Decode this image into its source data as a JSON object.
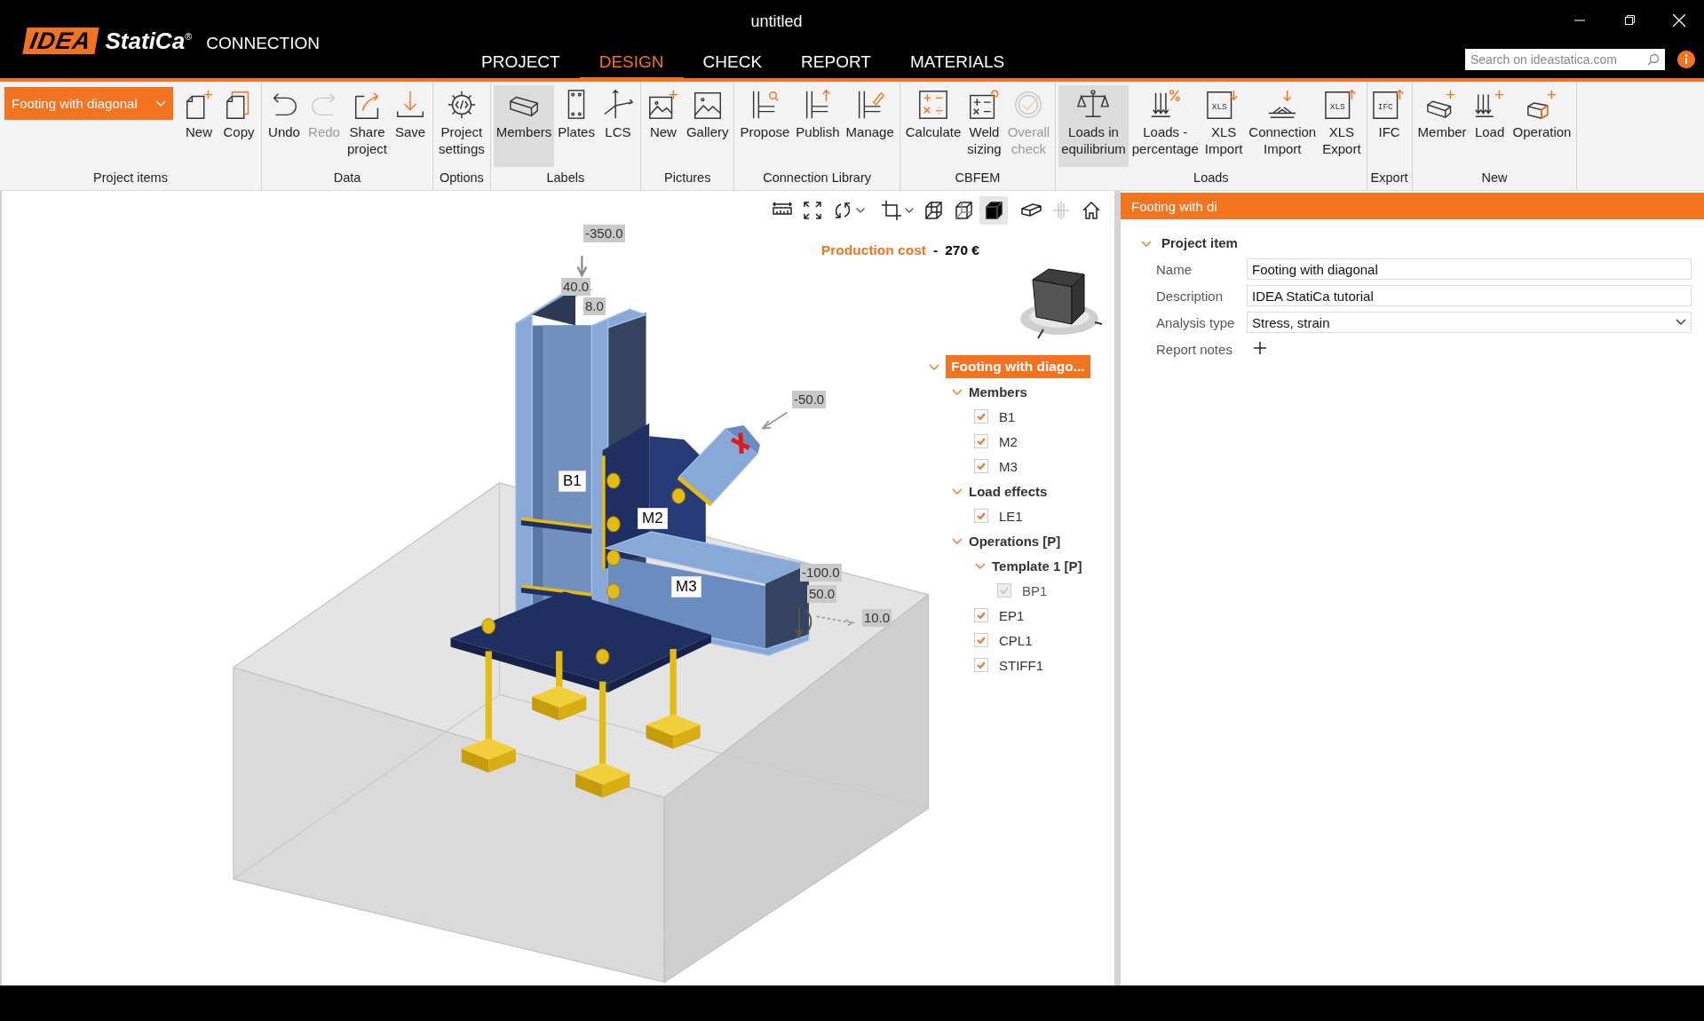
{
  "window": {
    "title": "untitled"
  },
  "logo": {
    "mark": "IDEA",
    "name": "StatiCa$^{®}$",
    "product": "CONNECTION"
  },
  "menu_tabs": [
    {
      "label": "PROJECT",
      "selected": false
    },
    {
      "label": "DESIGN",
      "selected": true
    },
    {
      "label": "CHECK",
      "selected": false
    },
    {
      "label": "REPORT",
      "selected": false
    },
    {
      "label": "MATERIALS",
      "selected": false
    }
  ],
  "search": {
    "placeholder": "Search on ideastatica.com"
  },
  "ribbon": {
    "project_item": "Footing with diagonal",
    "groups": [
      {
        "label": "Project items",
        "buttons": [
          {
            "lines": [
              "New"
            ],
            "selected": false,
            "disabled": false
          },
          {
            "lines": [
              "Copy"
            ],
            "selected": false,
            "disabled": false
          }
        ]
      },
      {
        "label": "Data",
        "buttons": [
          {
            "lines": [
              "Undo"
            ],
            "selected": false,
            "disabled": false
          },
          {
            "lines": [
              "Redo"
            ],
            "selected": false,
            "disabled": true
          },
          {
            "lines": [
              "Share",
              "project"
            ],
            "selected": false,
            "disabled": false
          },
          {
            "lines": [
              "Save"
            ],
            "selected": false,
            "disabled": false
          }
        ]
      },
      {
        "label": "Options",
        "buttons": [
          {
            "lines": [
              "Project",
              "settings"
            ],
            "selected": false,
            "disabled": false
          }
        ]
      },
      {
        "label": "Labels",
        "buttons": [
          {
            "lines": [
              "Members"
            ],
            "selected": true,
            "disabled": false
          },
          {
            "lines": [
              "Plates"
            ],
            "selected": false,
            "disabled": false
          },
          {
            "lines": [
              "LCS"
            ],
            "selected": false,
            "disabled": false
          }
        ]
      },
      {
        "label": "Pictures",
        "buttons": [
          {
            "lines": [
              "New"
            ],
            "selected": false,
            "disabled": false
          },
          {
            "lines": [
              "Gallery"
            ],
            "selected": false,
            "disabled": false
          }
        ]
      },
      {
        "label": "Connection Library",
        "buttons": [
          {
            "lines": [
              "Propose"
            ],
            "selected": false,
            "disabled": false
          },
          {
            "lines": [
              "Publish"
            ],
            "selected": false,
            "disabled": false
          },
          {
            "lines": [
              "Manage"
            ],
            "selected": false,
            "disabled": false
          }
        ]
      },
      {
        "label": "CBFEM",
        "buttons": [
          {
            "lines": [
              "Calculate"
            ],
            "selected": false,
            "disabled": false
          },
          {
            "lines": [
              "Weld",
              "sizing"
            ],
            "selected": false,
            "disabled": false
          },
          {
            "lines": [
              "Overall",
              "check"
            ],
            "selected": false,
            "disabled": true
          }
        ]
      },
      {
        "label": "Loads",
        "buttons": [
          {
            "lines": [
              "Loads in",
              "equilibrium"
            ],
            "selected": true,
            "disabled": false
          },
          {
            "lines": [
              "Loads -",
              "percentage"
            ],
            "selected": false,
            "disabled": false
          },
          {
            "lines": [
              "XLS",
              "Import"
            ],
            "icon_text": "XLS",
            "selected": false,
            "disabled": false
          },
          {
            "lines": [
              "Connection",
              "Import"
            ],
            "selected": false,
            "disabled": false
          },
          {
            "lines": [
              "XLS",
              "Export"
            ],
            "icon_text": "XLS",
            "selected": false,
            "disabled": false
          }
        ]
      },
      {
        "label": "Export",
        "buttons": [
          {
            "lines": [
              "IFC"
            ],
            "icon_text": "IFC",
            "selected": false,
            "disabled": false
          }
        ]
      },
      {
        "label": "New",
        "buttons": [
          {
            "lines": [
              "Member"
            ],
            "selected": false,
            "disabled": false
          },
          {
            "lines": [
              "Load"
            ],
            "selected": false,
            "disabled": false
          },
          {
            "lines": [
              "Operation"
            ],
            "selected": false,
            "disabled": false
          }
        ]
      }
    ]
  },
  "view_toolbar": [
    {
      "selected": false,
      "disabled": false,
      "dropdown": false
    },
    {
      "selected": false,
      "disabled": false,
      "dropdown": false
    },
    {
      "selected": false,
      "disabled": false,
      "dropdown": true
    },
    {
      "selected": false,
      "disabled": false,
      "dropdown": true
    },
    {
      "selected": false,
      "disabled": false,
      "dropdown": false
    },
    {
      "selected": false,
      "disabled": false,
      "dropdown": false
    },
    {
      "selected": true,
      "disabled": false,
      "dropdown": false
    },
    {
      "selected": false,
      "disabled": false,
      "dropdown": false
    },
    {
      "selected": false,
      "disabled": true,
      "dropdown": false
    },
    {
      "selected": false,
      "disabled": false,
      "dropdown": false
    }
  ],
  "production_cost": {
    "label": "Production cost",
    "separator": "-",
    "value": "270 €"
  },
  "scene": {
    "member_labels": [
      "B1",
      "M2",
      "M3"
    ],
    "load_labels": [
      "-350.0",
      "40.0",
      "8.0",
      "-50.0",
      "-100.0",
      "50.0",
      "10.0"
    ]
  },
  "tree": {
    "label": "Footing with diago...",
    "selected": true,
    "expanded": true,
    "children": [
      {
        "kind": "group",
        "label": "Members",
        "expanded": true,
        "children": [
          {
            "kind": "item",
            "label": "B1",
            "checked": true,
            "disabled": false
          },
          {
            "kind": "item",
            "label": "M2",
            "checked": true,
            "disabled": false
          },
          {
            "kind": "item",
            "label": "M3",
            "checked": true,
            "disabled": false
          }
        ]
      },
      {
        "kind": "group",
        "label": "Load effects",
        "expanded": true,
        "children": [
          {
            "kind": "item",
            "label": "LE1",
            "checked": true,
            "disabled": false
          }
        ]
      },
      {
        "kind": "group",
        "label": "Operations [P]",
        "expanded": true,
        "children": [
          {
            "kind": "group",
            "label": "Template 1 [P]",
            "expanded": true,
            "children": [
              {
                "kind": "item",
                "label": "BP1",
                "checked": true,
                "disabled": true
              }
            ]
          },
          {
            "kind": "item",
            "label": "EP1",
            "checked": true,
            "disabled": false
          },
          {
            "kind": "item",
            "label": "CPL1",
            "checked": true,
            "disabled": false
          },
          {
            "kind": "item",
            "label": "STIFF1",
            "checked": true,
            "disabled": false
          }
        ]
      }
    ]
  },
  "properties": {
    "header": "Footing with di",
    "section": {
      "label": "Project item",
      "expanded": true
    },
    "rows": [
      {
        "kind": "text",
        "label": "Name",
        "value": "Footing with diagonal"
      },
      {
        "kind": "text",
        "label": "Description",
        "value": "IDEA StatiCa tutorial"
      },
      {
        "kind": "select",
        "label": "Analysis type",
        "value": "Stress, strain"
      },
      {
        "kind": "add",
        "label": "Report notes"
      }
    ]
  }
}
